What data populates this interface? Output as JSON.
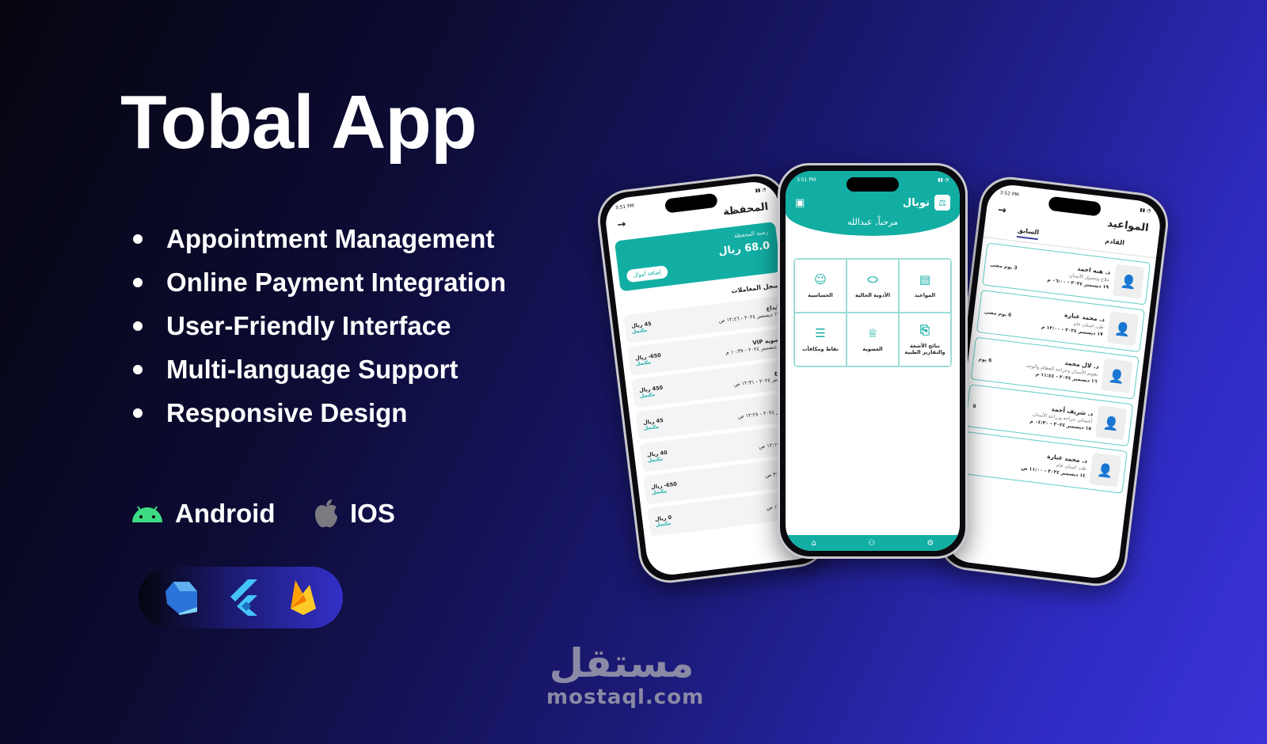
{
  "hero": {
    "title": "Tobal App",
    "features": [
      "Appointment Management",
      "Online Payment Integration",
      "User-Friendly Interface",
      "Multi-language Support",
      "Responsive Design"
    ],
    "platforms": [
      {
        "icon": "android-icon",
        "label": "Android",
        "color": "#3ddc84"
      },
      {
        "icon": "apple-icon",
        "label": "IOS",
        "color": "#8a8a8f"
      }
    ],
    "tech": [
      "dart-icon",
      "flutter-icon",
      "firebase-icon"
    ]
  },
  "watermark": {
    "arabic": "مستقل",
    "domain": "mostaql.com"
  },
  "colors": {
    "teal": "#12aea4",
    "background_dark": "#05050f",
    "background_accent": "#3a33d6"
  },
  "wallet_screen": {
    "time": "3:51 PM",
    "title": "المحفظة",
    "balance_label": "رصيد المحفظة",
    "balance": "68.0 ريال",
    "add_funds": "إضافة أموال",
    "history_title": "سجل المعاملات",
    "transactions": [
      {
        "title": "ايداع",
        "date": "١٩ ديسمبر ٢٠٢٤ - ١٢:٤٦ ص",
        "amount": "45 ريال",
        "status": "مكتمل"
      },
      {
        "title": "عضوية VIP",
        "date": "١٨ ديسمبر ٢٠٢٤ - ١٠:٣٧ م",
        "amount": "650- ريال",
        "status": "مكتمل"
      },
      {
        "title": "ايداع",
        "date": "ديسمبر ٢٠٢٤ - ١٢:٣١ ص",
        "amount": "450 ريال",
        "status": "مكتمل"
      },
      {
        "title": "ايداع",
        "date": "ديسمبر ٢٠٢٤ - ١٢:٢٨ ص",
        "amount": "45 ريال",
        "status": "مكتمل"
      },
      {
        "title": "ايداع",
        "date": "٢٠٢٤ - ١٢:١٢ ص",
        "amount": "40 ريال",
        "status": "مكتمل"
      },
      {
        "title": "",
        "date": "٢٠٢٤ - ٣:٢٨ ص",
        "amount": "650- ريال",
        "status": "مكتمل"
      },
      {
        "title": "",
        "date": "٢٠٢٤ - ١٢:١٥ ص",
        "amount": "0 ريال",
        "status": "مكتمل"
      }
    ]
  },
  "home_screen": {
    "time": "3:51 PM",
    "brand": "توبال",
    "greeting": "مرحباً, عبدالله",
    "grid": [
      {
        "label": "المواعيد",
        "icon": "calendar-icon"
      },
      {
        "label": "الأدوية الحالية",
        "icon": "pill-icon"
      },
      {
        "label": "الحساسية",
        "icon": "mask-face-icon"
      },
      {
        "label": "نتائج الأشعة والتقارير الطبية",
        "icon": "report-icon"
      },
      {
        "label": "العضوية",
        "icon": "crown-icon"
      },
      {
        "label": "نقاط ومكافآت",
        "icon": "coins-icon"
      }
    ]
  },
  "appointments_screen": {
    "time": "3:52 PM",
    "title": "المواعيد",
    "tabs": [
      "القادم",
      "السابق"
    ],
    "active_tab": "السابق",
    "items": [
      {
        "name": "د. هبه احمد",
        "specialty": "علاج وتجميل الأسنان",
        "date": "١٩ ديسمبر ٢٠٢٤ - ٠٦:٠٠ م",
        "ago": "3 يوم مضى"
      },
      {
        "name": "د. محمد عبارة",
        "specialty": "طب اسنان عام",
        "date": "١٧ ديسمبر ٢٠٢٤ - ١٢:٠٠ م",
        "ago": "6 يوم مضى"
      },
      {
        "name": "د. لال محمد",
        "specialty": "تقويم الأسنان وجراحة العظام والوجه",
        "date": "١٦ ديسمبر ٢٠٢٤ - ١١:٤٤ م",
        "ago": "6 يوم"
      },
      {
        "name": "د. شريف أحمد",
        "specialty": "أخصائي جراحة وزراعة الأسنان",
        "date": "١٥ ديسمبر ٢٠٢٤ - ٠٤:٣٠ م",
        "ago": "8"
      },
      {
        "name": "د. محمد عبارة",
        "specialty": "طب اسنان عام",
        "date": "١٤ ديسمبر ٢٠٢٤ - ١١:٠٠ ص",
        "ago": ""
      }
    ]
  }
}
